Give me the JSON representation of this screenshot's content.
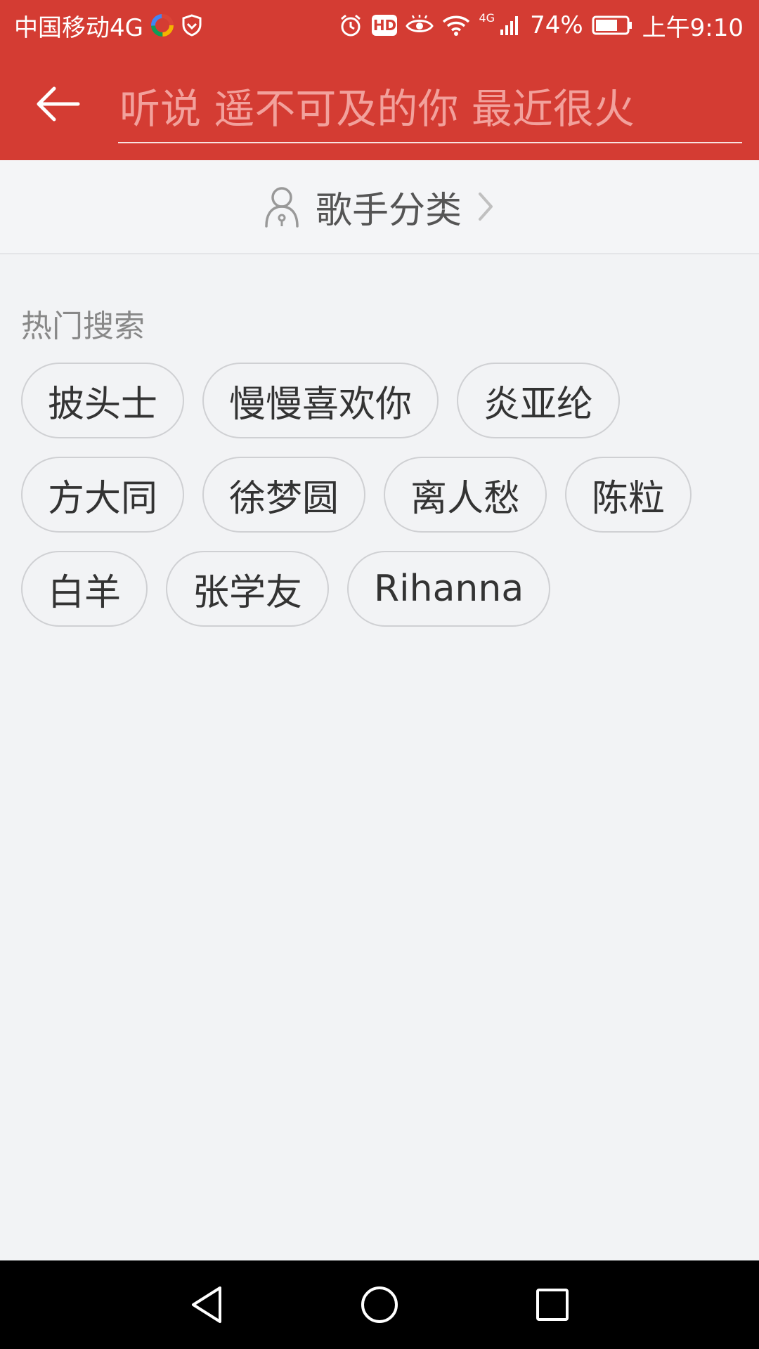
{
  "status_bar": {
    "carrier": "中国移动4G",
    "battery_percent": "74%",
    "time": "上午9:10",
    "network_badge": "4G",
    "hd_badge": "HD",
    "icons": [
      "app-colorful-icon",
      "shield-icon",
      "alarm-icon",
      "hd-icon",
      "eye-icon",
      "wifi-icon",
      "signal-icon",
      "battery-icon"
    ]
  },
  "header": {
    "back_icon": "arrow-left-icon",
    "search_placeholder": "听说 遥不可及的你 最近很火",
    "search_value": ""
  },
  "singer_category": {
    "label": "歌手分类",
    "icon": "person-icon",
    "chevron": "chevron-right-icon"
  },
  "hot_search": {
    "title": "热门搜索",
    "rows": [
      [
        "披头士",
        "慢慢喜欢你",
        "炎亚纶"
      ],
      [
        "方大同",
        "徐梦圆",
        "离人愁",
        "陈粒"
      ],
      [
        "白羊",
        "张学友",
        "Rihanna"
      ]
    ]
  },
  "colors": {
    "primary": "#d43c33",
    "background": "#f2f3f5",
    "tag_border": "#cfd0d3"
  },
  "nav_bar": {
    "icons": [
      "back-triangle-icon",
      "home-circle-icon",
      "recents-square-icon"
    ]
  }
}
